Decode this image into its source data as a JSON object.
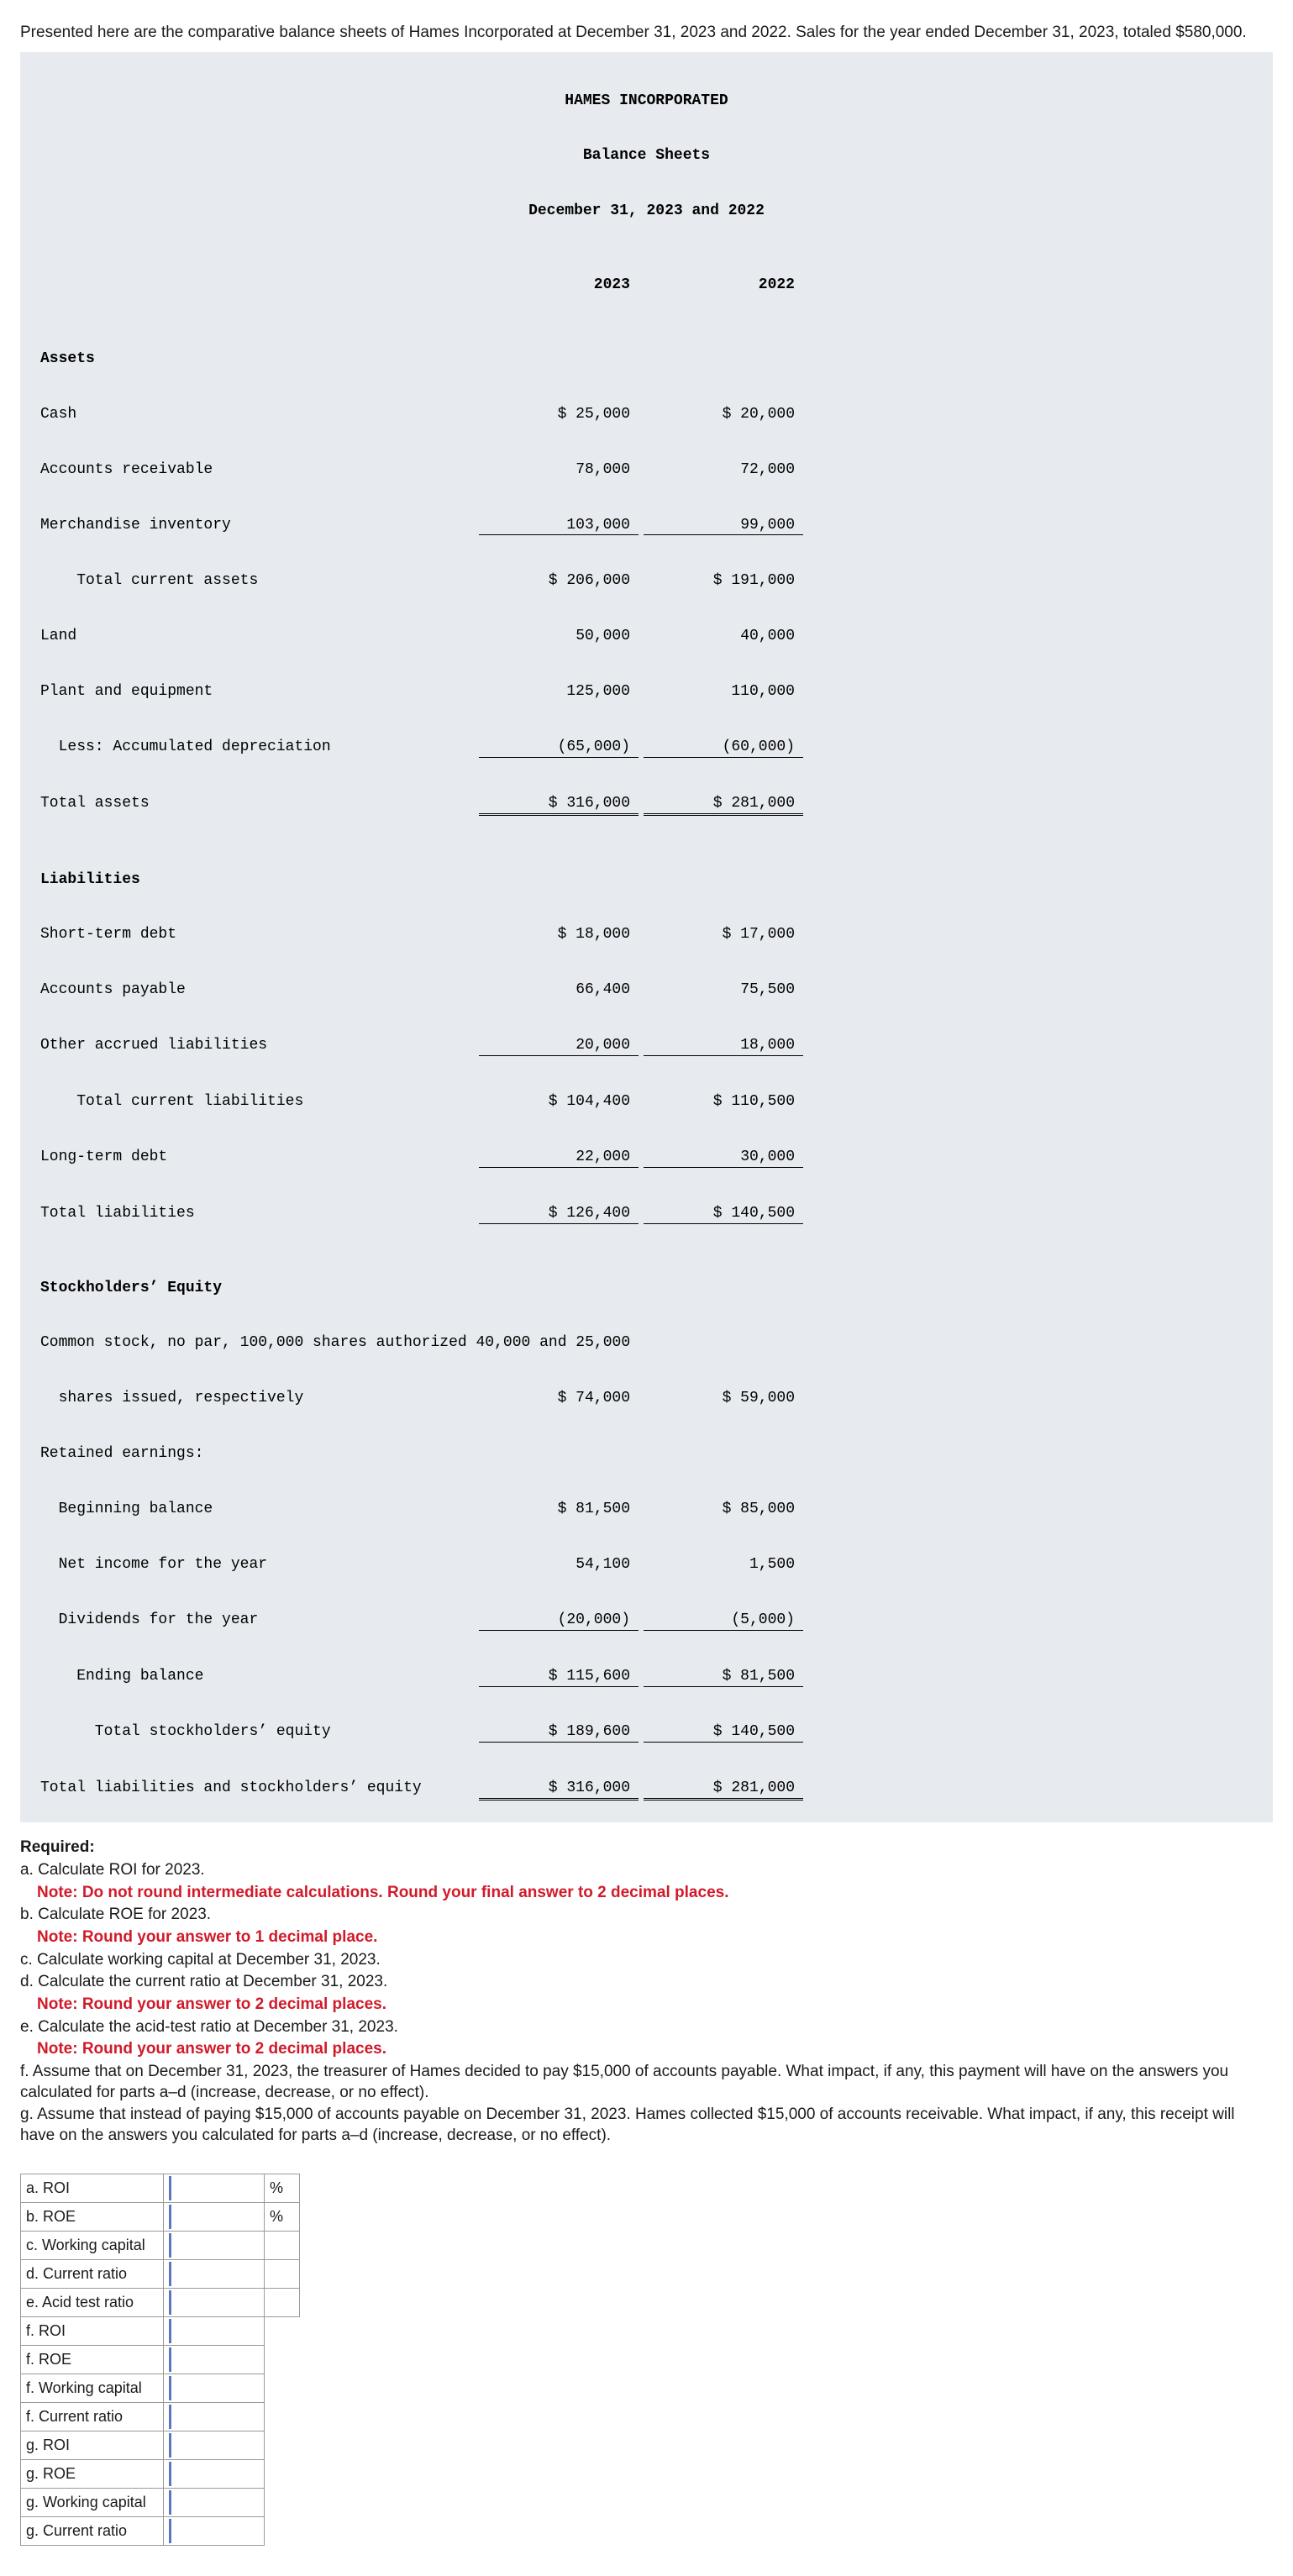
{
  "intro": "Presented here are the comparative balance sheets of Hames Incorporated at December 31, 2023 and 2022. Sales for the year ended December 31, 2023, totaled $580,000.",
  "sheet": {
    "h1": "HAMES INCORPORATED",
    "h2": "Balance Sheets",
    "h3": "December 31, 2023 and 2022",
    "col1": "2023",
    "col2": "2022",
    "assets_hdr": "Assets",
    "cash_l": "Cash",
    "cash_23": "$ 25,000",
    "cash_22": "$ 20,000",
    "ar_l": "Accounts receivable",
    "ar_23": "78,000",
    "ar_22": "72,000",
    "mi_l": "Merchandise inventory",
    "mi_23": "103,000",
    "mi_22": "99,000",
    "tca_l": "    Total current assets",
    "tca_23": "$ 206,000",
    "tca_22": "$ 191,000",
    "land_l": "Land",
    "land_23": "50,000",
    "land_22": "40,000",
    "pe_l": "Plant and equipment",
    "pe_23": "125,000",
    "pe_22": "110,000",
    "ad_l": "  Less: Accumulated depreciation",
    "ad_23": "(65,000)",
    "ad_22": "(60,000)",
    "ta_l": "Total assets",
    "ta_23": "$ 316,000",
    "ta_22": "$ 281,000",
    "liab_hdr": "Liabilities",
    "std_l": "Short-term debt",
    "std_23": "$ 18,000",
    "std_22": "$ 17,000",
    "ap_l": "Accounts payable",
    "ap_23": "66,400",
    "ap_22": "75,500",
    "oal_l": "Other accrued liabilities",
    "oal_23": "20,000",
    "oal_22": "18,000",
    "tcl_l": "    Total current liabilities",
    "tcl_23": "$ 104,400",
    "tcl_22": "$ 110,500",
    "ltd_l": "Long-term debt",
    "ltd_23": "22,000",
    "ltd_22": "30,000",
    "tl_l": "Total liabilities",
    "tl_23": "$ 126,400",
    "tl_22": "$ 140,500",
    "se_hdr": "Stockholders’ Equity",
    "cs_l1": "Common stock, no par, 100,000 shares authorized 40,000 and 25,000",
    "cs_l2": "  shares issued, respectively",
    "cs_23": "$ 74,000",
    "cs_22": "$ 59,000",
    "re_l": "Retained earnings:",
    "bb_l": "  Beginning balance",
    "bb_23": "$ 81,500",
    "bb_22": "$ 85,000",
    "ni_l": "  Net income for the year",
    "ni_23": "54,100",
    "ni_22": "1,500",
    "div_l": "  Dividends for the year",
    "div_23": "(20,000)",
    "div_22": "(5,000)",
    "eb_l": "    Ending balance",
    "eb_23": "$ 115,600",
    "eb_22": "$ 81,500",
    "tse_l": "      Total stockholders’ equity",
    "tse_23": "$ 189,600",
    "tse_22": "$ 140,500",
    "tlse_l": "Total liabilities and stockholders’ equity",
    "tlse_23": "$ 316,000",
    "tlse_22": "$ 281,000"
  },
  "required": {
    "title": "Required:",
    "a": "a. Calculate ROI for 2023.",
    "a_note": "Note: Do not round intermediate calculations. Round your final answer to 2 decimal places.",
    "b": "b. Calculate ROE for 2023.",
    "b_note": "Note: Round your answer to 1 decimal place.",
    "c": "c. Calculate working capital at December 31, 2023.",
    "d": "d. Calculate the current ratio at December 31, 2023.",
    "d_note": "Note: Round your answer to 2 decimal places.",
    "e": "e. Calculate the acid-test ratio at December 31, 2023.",
    "e_note": "Note: Round your answer to 2 decimal places.",
    "f": "f. Assume that on December 31, 2023, the treasurer of Hames decided to pay $15,000 of accounts payable. What impact, if any, this payment will have on the answers you calculated for parts a–d (increase, decrease, or no effect).",
    "g": "g. Assume that instead of paying $15,000 of accounts payable on December 31, 2023. Hames collected $15,000 of accounts receivable. What impact, if any, this receipt will have on the answers you calculated for parts a–d (increase, decrease, or no effect)."
  },
  "answers": {
    "rows": [
      {
        "label": "a. ROI",
        "unit": "%"
      },
      {
        "label": "b. ROE",
        "unit": "%"
      },
      {
        "label": "c. Working capital",
        "unit": ""
      },
      {
        "label": "d. Current ratio",
        "unit": ""
      },
      {
        "label": "e. Acid test ratio",
        "unit": ""
      },
      {
        "label": "f. ROI",
        "unit": null
      },
      {
        "label": "f. ROE",
        "unit": null
      },
      {
        "label": "f. Working capital",
        "unit": null
      },
      {
        "label": "f. Current ratio",
        "unit": null
      },
      {
        "label": "g. ROI",
        "unit": null
      },
      {
        "label": "g. ROE",
        "unit": null
      },
      {
        "label": "g. Working capital",
        "unit": null
      },
      {
        "label": "g. Current ratio",
        "unit": null
      }
    ]
  }
}
